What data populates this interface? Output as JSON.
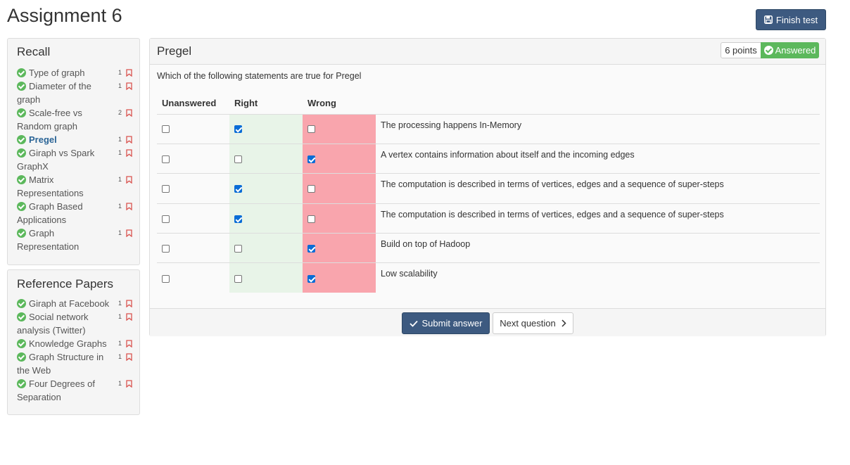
{
  "page": {
    "title": "Assignment 6"
  },
  "toolbar": {
    "finish_label": "Finish test"
  },
  "sidebar": {
    "recall": {
      "title": "Recall",
      "items": [
        {
          "label": "Type of graph",
          "count": "1",
          "active": false
        },
        {
          "label": "Diameter of the graph",
          "count": "1",
          "active": false
        },
        {
          "label": "Scale-free vs Random graph",
          "count": "2",
          "active": false
        },
        {
          "label": "Pregel",
          "count": "1",
          "active": true
        },
        {
          "label": "Giraph vs Spark GraphX",
          "count": "1",
          "active": false
        },
        {
          "label": "Matrix Representations",
          "count": "1",
          "active": false
        },
        {
          "label": "Graph Based Applications",
          "count": "1",
          "active": false
        },
        {
          "label": "Graph Representation",
          "count": "1",
          "active": false
        }
      ]
    },
    "papers": {
      "title": "Reference Papers",
      "items": [
        {
          "label": "Giraph at Facebook",
          "count": "1",
          "active": false
        },
        {
          "label": "Social network analysis (Twitter)",
          "count": "1",
          "active": false
        },
        {
          "label": "Knowledge Graphs",
          "count": "1",
          "active": false
        },
        {
          "label": "Graph Structure in the Web",
          "count": "1",
          "active": false
        },
        {
          "label": "Four Degrees of Separation",
          "count": "1",
          "active": false
        }
      ]
    }
  },
  "question": {
    "title": "Pregel",
    "points": "6 points",
    "status": "Answered",
    "text": "Which of the following statements are true for Pregel",
    "columns": {
      "unanswered": "Unanswered",
      "right": "Right",
      "wrong": "Wrong"
    },
    "rows": [
      {
        "statement": "The processing happens In-Memory",
        "answer": "right"
      },
      {
        "statement": "A vertex contains information about itself and the incoming edges",
        "answer": "wrong"
      },
      {
        "statement": "The computation is described in terms of vertices, edges and a sequence of super-steps",
        "answer": "right"
      },
      {
        "statement": "The computation is described in terms of vertices, edges and a sequence of super-steps",
        "answer": "right"
      },
      {
        "statement": "Build on top of Hadoop",
        "answer": "wrong"
      },
      {
        "statement": "Low scalability",
        "answer": "wrong"
      }
    ]
  },
  "footer": {
    "submit_label": "Submit answer",
    "next_label": "Next question"
  },
  "colors": {
    "primary": "#3d5a80",
    "success": "#5cb85c",
    "right_bg": "#e8f4e8",
    "wrong_bg": "#f9a5ad",
    "checkbox": "#0a6cd6"
  }
}
